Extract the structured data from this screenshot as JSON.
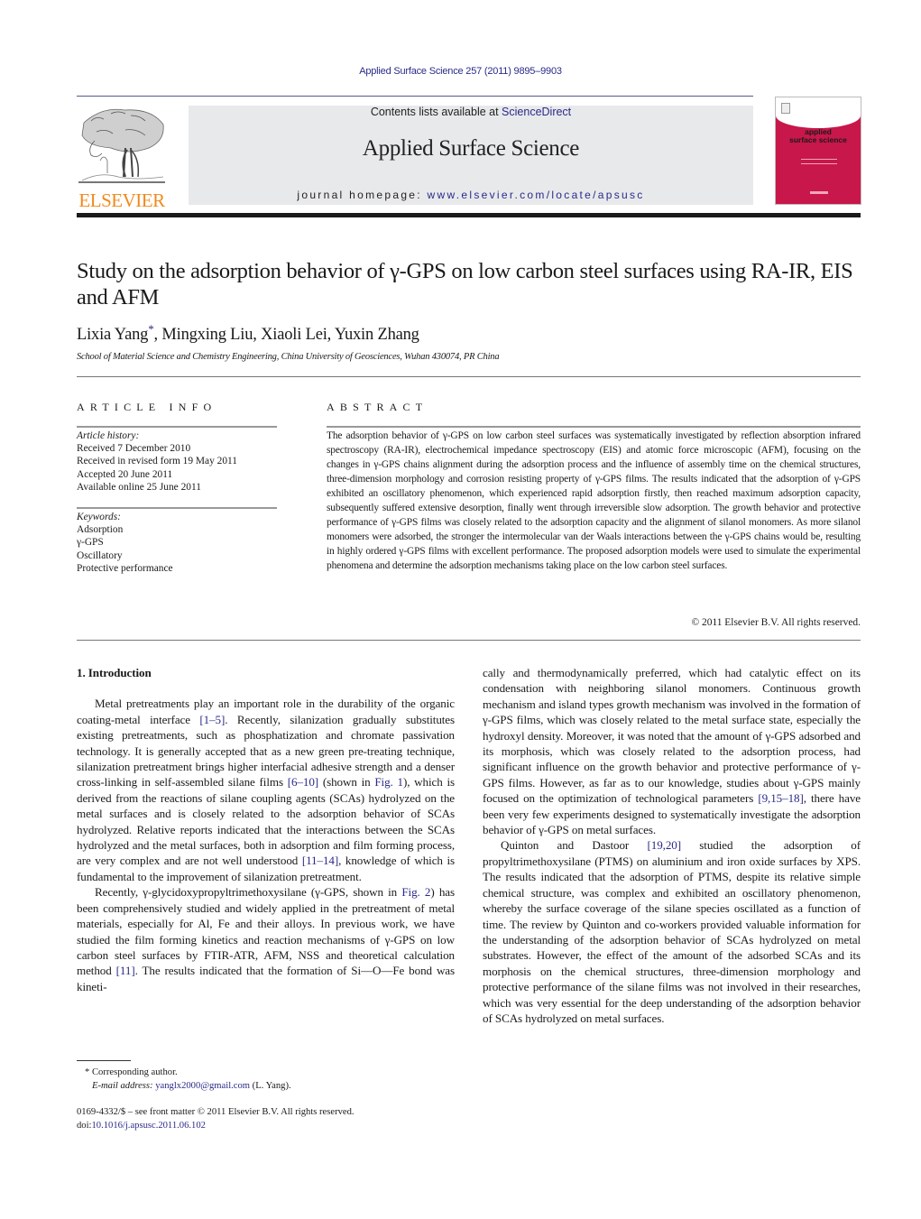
{
  "header": {
    "citation": "Applied Surface Science 257 (2011) 9895–9903",
    "contents_prefix": "Contents lists available at ",
    "contents_link": "ScienceDirect",
    "journal_name": "Applied Surface Science",
    "homepage_prefix": "journal homepage: ",
    "homepage_link": "www.elsevier.com/locate/apsusc",
    "publisher_logo_text": "ELSEVIER",
    "cover_title_line1": "applied",
    "cover_title_line2": "surface science",
    "colors": {
      "link": "#2a2a8a",
      "elsevier_orange": "#f08a1c",
      "cover_red": "#c8174a",
      "masthead_bg": "#e8e9eb"
    }
  },
  "article": {
    "title": "Study on the adsorption behavior of γ-GPS on low carbon steel surfaces using RA-IR, EIS and AFM",
    "authors": [
      {
        "name": "Lixia Yang",
        "mark": "*"
      },
      {
        "name": "Mingxing Liu"
      },
      {
        "name": "Xiaoli Lei"
      },
      {
        "name": "Yuxin Zhang"
      }
    ],
    "author_separator": ", ",
    "affiliation": "School of Material Science and Chemistry Engineering, China University of Geosciences, Wuhan 430074, PR China"
  },
  "article_info": {
    "heading": "ARTICLE INFO",
    "history_label": "Article history:",
    "history": [
      "Received 7 December 2010",
      "Received in revised form 19 May 2011",
      "Accepted 20 June 2011",
      "Available online 25 June 2011"
    ],
    "keywords_label": "Keywords:",
    "keywords": [
      "Adsorption",
      "γ-GPS",
      "Oscillatory",
      "Protective performance"
    ]
  },
  "abstract": {
    "heading": "ABSTRACT",
    "text": "The adsorption behavior of γ-GPS on low carbon steel surfaces was systematically investigated by reflection absorption infrared spectroscopy (RA-IR), electrochemical impedance spectroscopy (EIS) and atomic force microscopic (AFM), focusing on the changes in γ-GPS chains alignment during the adsorption process and the influence of assembly time on the chemical structures, three-dimension morphology and corrosion resisting property of γ-GPS films. The results indicated that the adsorption of γ-GPS exhibited an oscillatory phenomenon, which experienced rapid adsorption firstly, then reached maximum adsorption capacity, subsequently suffered extensive desorption, finally went through irreversible slow adsorption. The growth behavior and protective performance of γ-GPS films was closely related to the adsorption capacity and the alignment of silanol monomers. As more silanol monomers were adsorbed, the stronger the intermolecular van der Waals interactions between the γ-GPS chains would be, resulting in highly ordered γ-GPS films with excellent performance. The proposed adsorption models were used to simulate the experimental phenomena and determine the adsorption mechanisms taking place on the low carbon steel surfaces.",
    "copyright": "© 2011 Elsevier B.V. All rights reserved."
  },
  "body": {
    "section_title": "1.  Introduction",
    "p1": {
      "a": "Metal pretreatments play an important role in the durability of the organic coating-metal interface ",
      "ref1": "[1–5]",
      "b": ". Recently, silanization gradually substitutes existing pretreatments, such as phosphatization and chromate passivation technology. It is generally accepted that as a new green pre-treating technique, silanization pretreatment brings higher interfacial adhesive strength and a denser cross-linking in self-assembled silane films ",
      "ref2": "[6–10]",
      "c": " (shown in ",
      "fig1": "Fig. 1",
      "d": "), which is derived from the reactions of silane coupling agents (SCAs) hydrolyzed on the metal surfaces and is closely related to the adsorption behavior of SCAs hydrolyzed. Relative reports indicated that the interactions between the SCAs hydrolyzed and the metal surfaces, both in adsorption and film forming process, are very complex and are not well understood ",
      "ref3": "[11–14]",
      "e": ", knowledge of which is fundamental to the improvement of silanization pretreatment."
    },
    "p2": {
      "a": "Recently, γ-glycidoxypropyltrimethoxysilane (γ-GPS, shown in ",
      "fig2": "Fig. 2",
      "b": ") has been comprehensively studied and widely applied in the pretreatment of metal materials, especially for Al, Fe and their alloys. In previous work, we have studied the film forming kinetics and reaction mechanisms of γ-GPS on low carbon steel surfaces by FTIR-ATR, AFM, NSS and theoretical calculation method ",
      "ref1": "[11]",
      "c": ". The results indicated that the formation of Si—O—Fe bond was kineti-"
    },
    "p2_cont": {
      "a": "cally and thermodynamically preferred, which had catalytic effect on its condensation with neighboring silanol monomers. Continuous growth mechanism and island types growth mechanism was involved in the formation of γ-GPS films, which was closely related to the metal surface state, especially the hydroxyl density. Moreover, it was noted that the amount of γ-GPS adsorbed and its morphosis, which was closely related to the adsorption process, had significant influence on the growth behavior and protective performance of γ-GPS films. However, as far as to our knowledge, studies about γ-GPS mainly focused on the optimization of technological parameters ",
      "ref1": "[9,15–18]",
      "b": ", there have been very few experiments designed to systematically investigate the adsorption behavior of γ-GPS on metal surfaces."
    },
    "p3": {
      "a": "Quinton and Dastoor ",
      "ref1": "[19,20]",
      "b": " studied the adsorption of propyltrimethoxysilane (PTMS) on aluminium and iron oxide surfaces by XPS. The results indicated that the adsorption of PTMS, despite its relative simple chemical structure, was complex and exhibited an oscillatory phenomenon, whereby the surface coverage of the silane species oscillated as a function of time. The review by Quinton and co-workers provided valuable information for the understanding of the adsorption behavior of SCAs hydrolyzed on metal substrates. However, the effect of the amount of the adsorbed SCAs and its morphosis on the chemical structures, three-dimension morphology and protective performance of the silane films was not involved in their researches, which was very essential for the deep understanding of the adsorption behavior of SCAs hydrolyzed on metal surfaces."
    }
  },
  "footnotes": {
    "corresponding_mark": "*",
    "corresponding": " Corresponding author.",
    "email_label": "E-mail address:",
    "email": "yanglx2000@gmail.com",
    "email_suffix": " (L. Yang).",
    "front_matter": "0169-4332/$ – see front matter © 2011 Elsevier B.V. All rights reserved.",
    "doi_prefix": "doi:",
    "doi": "10.1016/j.apsusc.2011.06.102"
  }
}
